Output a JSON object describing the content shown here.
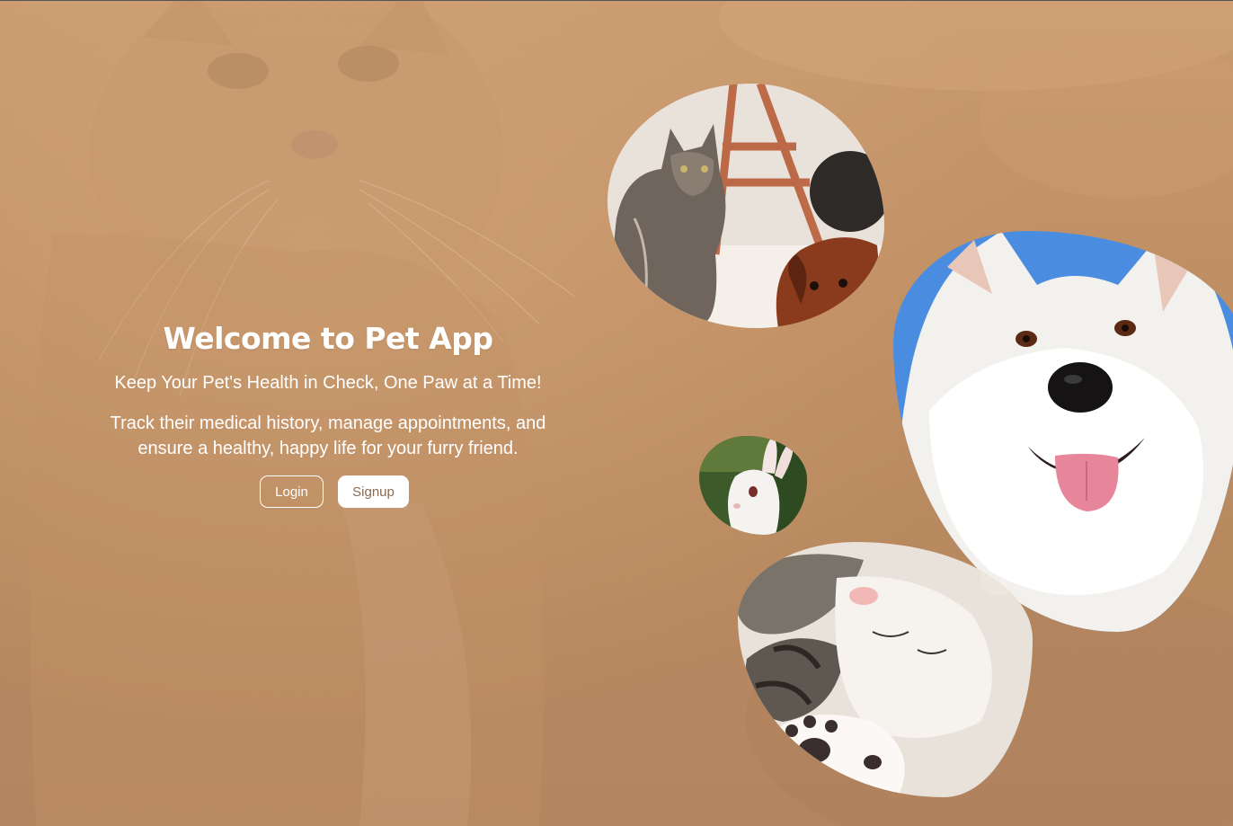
{
  "hero": {
    "title": "Welcome to Pet App",
    "tagline": "Keep Your Pet's Health in Check, One Paw at a Time!",
    "description": "Track their medical history, manage appointments, and ensure a healthy, happy life for your furry friend."
  },
  "actions": {
    "login_label": "Login",
    "signup_label": "Signup"
  },
  "colors": {
    "background": "#c29168",
    "text": "#ffffff",
    "signup_text": "#8a6a52"
  },
  "gallery": [
    {
      "subject": "cat-and-dog-photo"
    },
    {
      "subject": "white-samoyed-photo"
    },
    {
      "subject": "white-bunny-photo"
    },
    {
      "subject": "sleeping-kitten-photo"
    }
  ]
}
